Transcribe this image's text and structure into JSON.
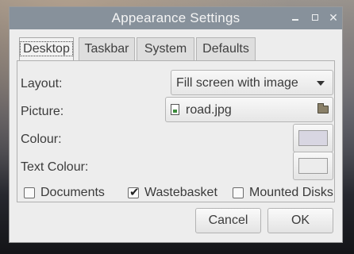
{
  "window": {
    "title": "Appearance Settings",
    "controls": [
      "minimize",
      "maximize",
      "close"
    ]
  },
  "tabs": [
    {
      "label": "Desktop",
      "active": true
    },
    {
      "label": "Taskbar",
      "active": false
    },
    {
      "label": "System",
      "active": false
    },
    {
      "label": "Defaults",
      "active": false
    }
  ],
  "desktop": {
    "layout_label": "Layout:",
    "layout_value": "Fill screen with image",
    "picture_label": "Picture:",
    "picture_value": "road.jpg",
    "colour_label": "Colour:",
    "colour_value": "#d8d6e2",
    "text_colour_label": "Text Colour:",
    "text_colour_value": "#ececec",
    "checkboxes": [
      {
        "label": "Documents",
        "checked": false
      },
      {
        "label": "Wastebasket",
        "checked": true
      },
      {
        "label": "Mounted Disks",
        "checked": false
      }
    ]
  },
  "buttons": {
    "cancel": "Cancel",
    "ok": "OK"
  },
  "colors": {
    "titlebar": "#87919b",
    "window_bg": "#ededed"
  }
}
